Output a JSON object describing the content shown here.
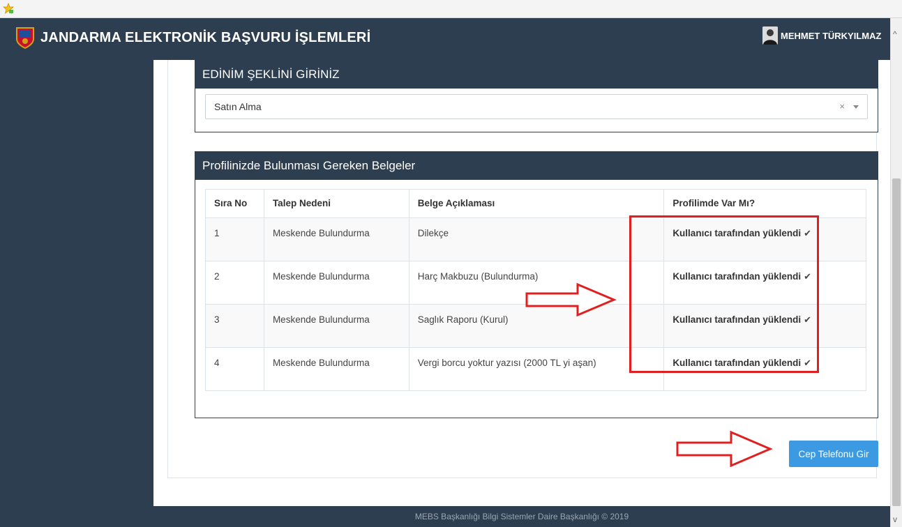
{
  "app": {
    "title": "JANDARMA ELEKTRONİK BAŞVURU İŞLEMLERİ"
  },
  "user": {
    "name": "MEHMET TÜRKYILMAZ"
  },
  "acquisition_panel": {
    "heading": "EDİNİM ŞEKLİNİ GİRİNİZ",
    "selected_value": "Satın Alma",
    "clear_glyph": "×"
  },
  "documents_panel": {
    "heading": "Profilinizde Bulunması Gereken Belgeler",
    "columns": [
      "Sıra No",
      "Talep Nedeni",
      "Belge Açıklaması",
      "Profilimde Var Mı?"
    ],
    "rows": [
      {
        "no": "1",
        "reason": "Meskende Bulundurma",
        "document": "Dilekçe",
        "status": "Kullanıcı tarafından yüklendi"
      },
      {
        "no": "2",
        "reason": "Meskende Bulundurma",
        "document": "Harç Makbuzu (Bulundurma)",
        "status": "Kullanıcı tarafından yüklendi"
      },
      {
        "no": "3",
        "reason": "Meskende Bulundurma",
        "document": "Saglık Raporu (Kurul)",
        "status": "Kullanıcı tarafından yüklendi"
      },
      {
        "no": "4",
        "reason": "Meskende Bulundurma",
        "document": "Vergi borcu yoktur yazısı (2000 TL yi aşan)",
        "status": "Kullanıcı tarafından yüklendi"
      }
    ],
    "check_glyph": "✔"
  },
  "actions": {
    "phone_button_label": "Cep Telefonu Gir"
  },
  "footer": {
    "text": "MEBS Başkanlığı Bilgi Sistemler Daire Başkanlığı © 2019"
  },
  "scroll": {
    "up_glyph": "^",
    "down_glyph": "v"
  },
  "colors": {
    "header_bg": "#2d3e50",
    "button_bg": "#3b9ae1",
    "annotation": "#e02020"
  }
}
